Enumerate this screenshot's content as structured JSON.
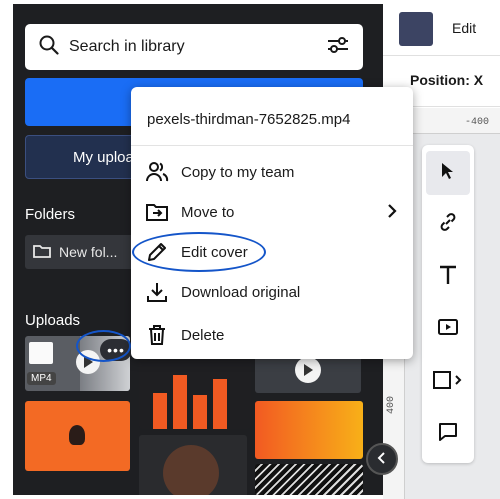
{
  "search": {
    "label": "Search in library",
    "icon": "search-icon",
    "filter_icon": "sliders-icon"
  },
  "library": {
    "upload_label": "My uploa",
    "folders_title": "Folders",
    "folder_chip": "New fol...",
    "uploads_title": "Uploads",
    "mp4_badge": "MP4",
    "more_label": "•••"
  },
  "right_panel": {
    "edit_label": "Edit",
    "position_label": "Position: X",
    "ruler_top": "-400",
    "ruler_left": "400",
    "swatch_color": "#3c4463"
  },
  "context_menu": {
    "title": "pexels-thirdman-7652825.mp4",
    "items": [
      {
        "label": "Copy to my team",
        "icon": "team-icon"
      },
      {
        "label": "Move to",
        "icon": "move-folder-icon"
      },
      {
        "label": "Edit cover",
        "icon": "pencil-icon"
      },
      {
        "label": "Download original",
        "icon": "download-icon"
      },
      {
        "label": "Delete",
        "icon": "trash-icon"
      }
    ]
  },
  "toolbar": {
    "tools": [
      "cursor-icon",
      "link-icon",
      "text-icon",
      "media-icon",
      "shape-icon",
      "comment-icon"
    ]
  },
  "colors": {
    "accent": "#1a6df5",
    "annotation": "#1455c9",
    "panel": "#1e1f22"
  }
}
